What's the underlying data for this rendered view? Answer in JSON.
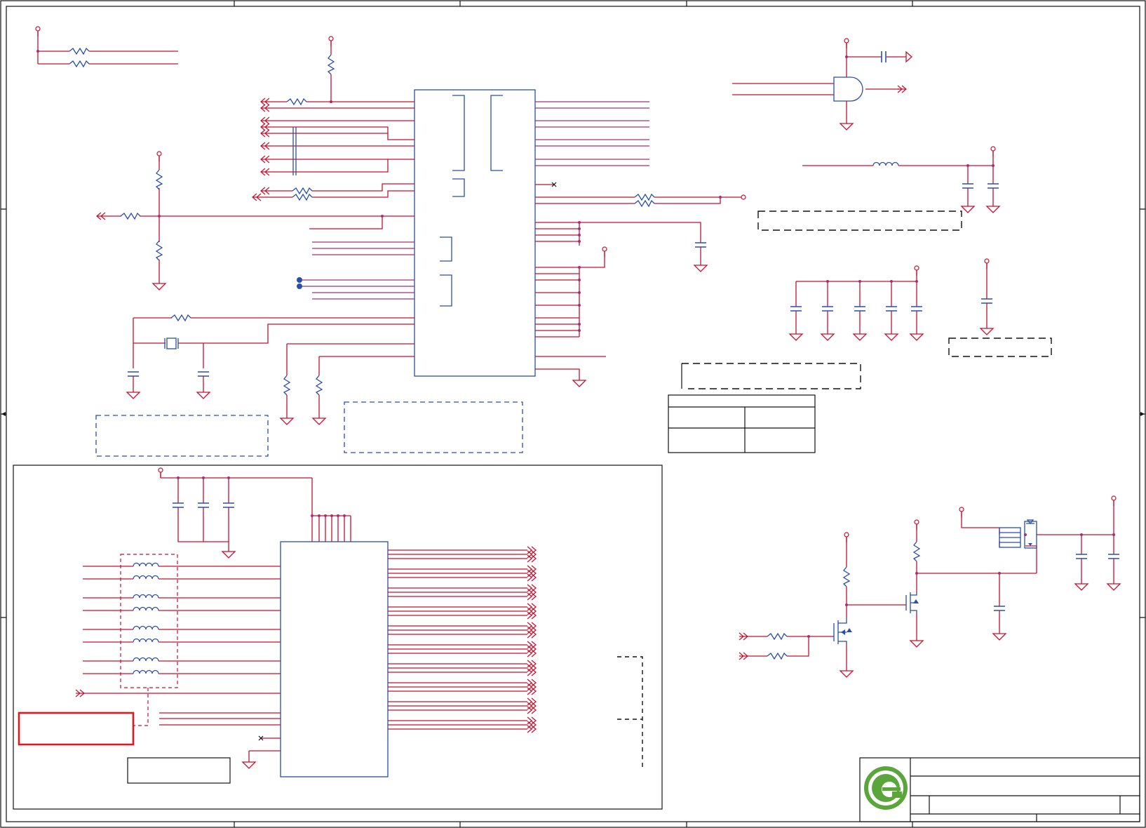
{
  "sheet": {
    "line_color": "#c8102e",
    "part_color": "#2a4fa8",
    "frame_color": "#111111",
    "highlight_color": "#e0191f"
  },
  "title_block": {
    "logo_icon": "company-logo-icon",
    "logo_colors": [
      "#5aa63b",
      "#2e8b2e"
    ]
  }
}
